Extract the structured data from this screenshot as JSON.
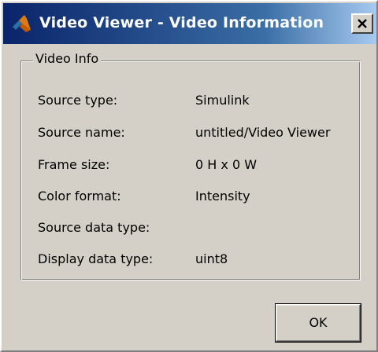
{
  "window": {
    "title": "Video Viewer - Video Information",
    "app_icon": "matlab-logo-icon",
    "close_icon": "close-icon"
  },
  "group": {
    "title": "Video Info",
    "rows": [
      {
        "label": "Source type:",
        "value": "Simulink"
      },
      {
        "label": "Source name:",
        "value": "untitled/Video Viewer"
      },
      {
        "label": "Frame size:",
        "value": "0 H x 0 W"
      },
      {
        "label": "Color format:",
        "value": "Intensity"
      },
      {
        "label": "Source data type:",
        "value": ""
      },
      {
        "label": "Display data type:",
        "value": "uint8"
      }
    ]
  },
  "buttons": {
    "ok_label": "OK"
  },
  "colors": {
    "dialog_background": "#d4d0c8",
    "titlebar_start": "#0a246a",
    "titlebar_end": "#a6caf0",
    "title_text": "#ffffff"
  }
}
